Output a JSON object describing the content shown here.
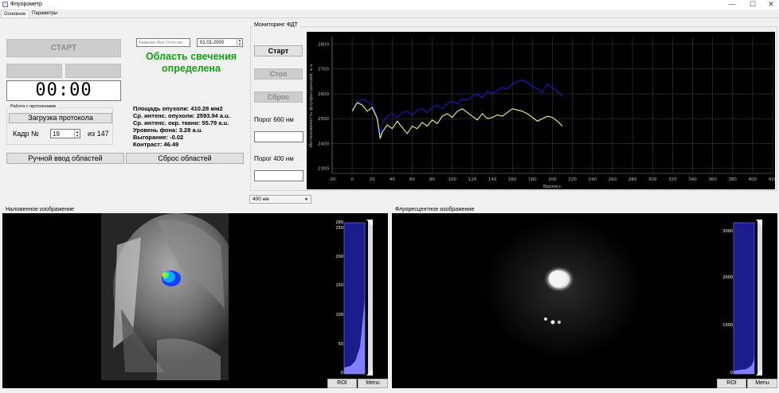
{
  "window": {
    "title": "Флуорометр",
    "minimize": "—",
    "maximize": "☐",
    "close": "✕"
  },
  "tabs": [
    {
      "label": "Основное"
    },
    {
      "label": "Параметры"
    }
  ],
  "left_controls": {
    "start_label": "СТАРТ",
    "timer": "00:00",
    "protocol_group_title": "Работа с протоколами",
    "load_protocol_label": "Загрузка протокола",
    "frame_label": "Кадр №",
    "frame_value": "19",
    "frame_total": "из 147",
    "manual_regions_label": "Ручной ввод областей",
    "reset_regions_label": "Сброс областей"
  },
  "patient": {
    "name_placeholder": "Фамилия Имя Отчество",
    "date": "01.01.2000"
  },
  "status": {
    "line1": "Область свечения",
    "line2": "определена",
    "color": "#12a012"
  },
  "stats": [
    "Площадь опухоли: 410.28 мм2",
    "Ср. интенс. опухоли: 2593.94 a.u.",
    "Ср. интенс. окр. ткани: 55.79 a.u.",
    "Уровень фона: 3.28 a.u.",
    "Выгорание: -0.02",
    "Контраст: 46.49"
  ],
  "monitoring": {
    "title": "Мониторинг ФДТ",
    "start_label": "Старт",
    "stop_label": "Стоп",
    "reset_label": "Сброс",
    "threshold_660_label": "Порог 660 нм",
    "threshold_400_label": "Порог 400 нм",
    "threshold_660_value": "",
    "threshold_400_value": "",
    "wavelength_select": "400 нм"
  },
  "chart_data": {
    "type": "line",
    "xlabel": "Время,с",
    "ylabel": "Интенсивность флуоресценции, a.u.",
    "xlim": [
      -20,
      420
    ],
    "ylim": [
      2280,
      2830
    ],
    "x_ticks": [
      -20,
      0,
      20,
      40,
      60,
      80,
      100,
      120,
      140,
      160,
      180,
      200,
      220,
      240,
      260,
      280,
      300,
      320,
      340,
      360,
      380,
      400,
      420
    ],
    "y_ticks": [
      2300,
      2400,
      2500,
      2600,
      2700,
      2800
    ],
    "grid": true,
    "background": "#000000",
    "series": [
      {
        "color": "#1a1ad8",
        "x": [
          0,
          5,
          10,
          15,
          20,
          25,
          28,
          30,
          35,
          40,
          45,
          50,
          55,
          60,
          65,
          70,
          75,
          80,
          85,
          90,
          95,
          100,
          105,
          110,
          115,
          120,
          125,
          130,
          135,
          140,
          145,
          150,
          155,
          160,
          165,
          170,
          175,
          180,
          185,
          190,
          195,
          200,
          205,
          210
        ],
        "values": [
          2535,
          2560,
          2580,
          2570,
          2555,
          2510,
          2430,
          2480,
          2510,
          2520,
          2505,
          2525,
          2530,
          2515,
          2535,
          2540,
          2525,
          2545,
          2555,
          2540,
          2560,
          2570,
          2560,
          2580,
          2575,
          2590,
          2600,
          2585,
          2610,
          2600,
          2615,
          2625,
          2620,
          2640,
          2650,
          2655,
          2645,
          2630,
          2620,
          2605,
          2640,
          2625,
          2610,
          2590
        ]
      },
      {
        "color": "#e6ff80",
        "x": [
          0,
          5,
          10,
          15,
          20,
          25,
          28,
          30,
          35,
          40,
          45,
          50,
          55,
          60,
          65,
          70,
          75,
          80,
          85,
          90,
          95,
          100,
          105,
          110,
          115,
          120,
          125,
          130,
          135,
          140,
          145,
          150,
          155,
          160,
          165,
          170,
          175,
          180,
          185,
          190,
          195,
          200,
          205,
          210
        ],
        "values": [
          2530,
          2565,
          2555,
          2530,
          2545,
          2500,
          2420,
          2445,
          2475,
          2460,
          2490,
          2465,
          2440,
          2470,
          2460,
          2485,
          2470,
          2495,
          2480,
          2510,
          2520,
          2505,
          2530,
          2540,
          2525,
          2510,
          2495,
          2520,
          2500,
          2505,
          2515,
          2510,
          2525,
          2540,
          2535,
          2530,
          2520,
          2505,
          2490,
          2500,
          2510,
          2505,
          2490,
          2470
        ]
      }
    ]
  },
  "overlay_panel": {
    "title": "Наложенное изображение",
    "hist_ticks": [
      "260",
      "250",
      "200",
      "150",
      "100",
      "50",
      "0"
    ],
    "roi_label": "ROI",
    "menu_label": "Menu"
  },
  "fluor_panel": {
    "title": "Флуоресцентное изображение",
    "hist_ticks": [
      "3000",
      "2000",
      "1000",
      "0"
    ],
    "roi_label": "ROI",
    "menu_label": "Menu"
  }
}
